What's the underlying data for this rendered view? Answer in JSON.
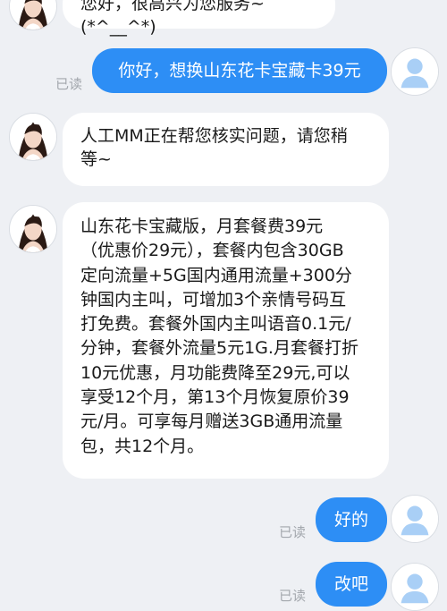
{
  "messages": {
    "m1": {
      "sender": "agent",
      "text": "您好，很高兴为您服务~(*^__^*)"
    },
    "m2": {
      "sender": "user",
      "text": "你好，想换山东花卡宝藏卡39元",
      "status": "已读"
    },
    "m3": {
      "sender": "agent",
      "text": "人工MM正在帮您核实问题，请您稍\n等~"
    },
    "m4": {
      "sender": "agent",
      "text": "山东花卡宝藏版，月套餐费39元\n（优惠价29元），套餐内包含30GB\n定向流量+5G国内通用流量+300分\n钟国内主叫，可增加3个亲情号码互\n打免费。套餐外国内主叫语音0.1元/\n分钟，套餐外流量5元1G.月套餐打折\n10元优惠，月功能费降至29元,可以\n享受12个月，第13个月恢复原价39\n元/月。可享每月赠送3GB通用流量\n包，共12个月。"
    },
    "m5": {
      "sender": "user",
      "text": "好的",
      "status": "已读"
    },
    "m6": {
      "sender": "user",
      "text": "改吧",
      "status": "已读"
    }
  },
  "colors": {
    "background": "#eef0f4",
    "user_bubble": "#2d8ef5",
    "agent_bubble": "#ffffff",
    "read_status": "#a3a7ad",
    "user_avatar": "#a9cff6"
  },
  "icons": {
    "agent_avatar": "agent-avatar-icon",
    "user_avatar": "user-avatar-icon"
  }
}
